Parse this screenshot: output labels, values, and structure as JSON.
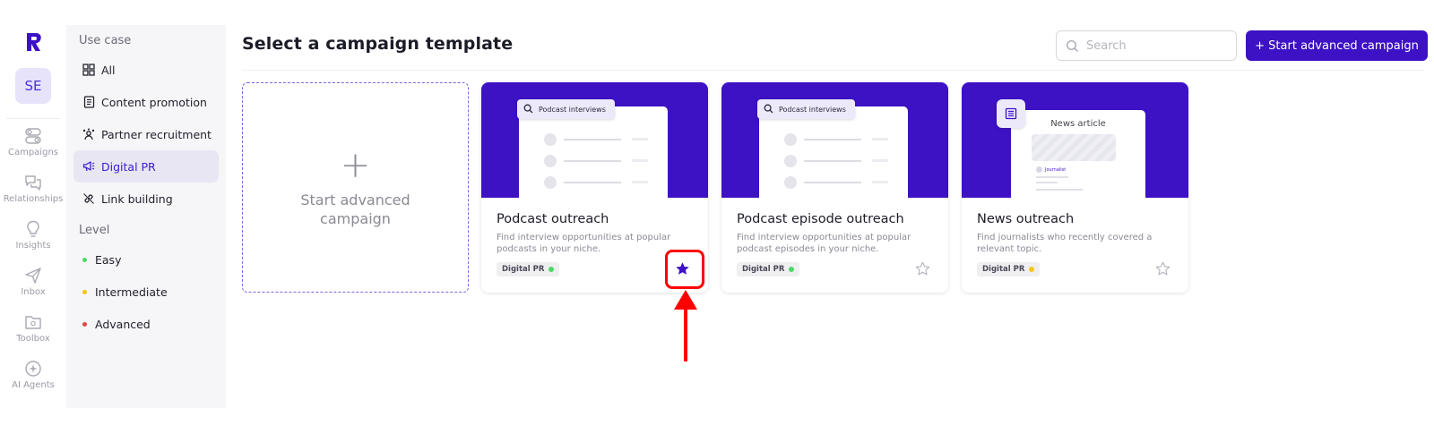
{
  "rail": {
    "avatar": "SE",
    "items": [
      {
        "label": "Campaigns",
        "icon": "campaigns-icon"
      },
      {
        "label": "Relationships",
        "icon": "relationships-icon"
      },
      {
        "label": "Insights",
        "icon": "lightbulb-icon"
      },
      {
        "label": "Inbox",
        "icon": "send-icon"
      },
      {
        "label": "Toolbox",
        "icon": "folder-icon"
      },
      {
        "label": "AI Agents",
        "icon": "ai-agent-icon"
      }
    ]
  },
  "filters": {
    "use_case_heading": "Use case",
    "use_cases": [
      {
        "label": "All",
        "icon": "grid-icon"
      },
      {
        "label": "Content promotion",
        "icon": "document-icon"
      },
      {
        "label": "Partner recruitment",
        "icon": "people-icon"
      },
      {
        "label": "Digital PR",
        "icon": "megaphone-icon",
        "active": true
      },
      {
        "label": "Link building",
        "icon": "link-icon"
      }
    ],
    "level_heading": "Level",
    "levels": [
      {
        "label": "Easy",
        "color": "#4cd964"
      },
      {
        "label": "Intermediate",
        "color": "#f5c518"
      },
      {
        "label": "Advanced",
        "color": "#e0483f"
      }
    ]
  },
  "header": {
    "title": "Select a campaign template",
    "search_placeholder": "Search",
    "start_button": "+ Start advanced campaign"
  },
  "new_card": {
    "plus": "+",
    "label": "Start advanced campaign"
  },
  "cards": [
    {
      "title": "Podcast outreach",
      "description": "Find interview opportunities at popular podcasts in your niche.",
      "chip": "Podcast interviews",
      "tag": "Digital PR",
      "tag_dot_color": "#4cd964",
      "starred": true
    },
    {
      "title": "Podcast episode outreach",
      "description": "Find interview opportunities at popular podcast episodes in your niche.",
      "chip": "Podcast interviews",
      "tag": "Digital PR",
      "tag_dot_color": "#4cd964",
      "starred": false
    },
    {
      "title": "News outreach",
      "description": "Find journalists who recently covered a relevant topic.",
      "mock_title": "News article",
      "mock_chip": "Journalist",
      "tag": "Digital PR",
      "tag_dot_color": "#f5c518",
      "starred": false
    }
  ],
  "colors": {
    "brand": "#3d11c4",
    "annotation": "#ff0000"
  }
}
